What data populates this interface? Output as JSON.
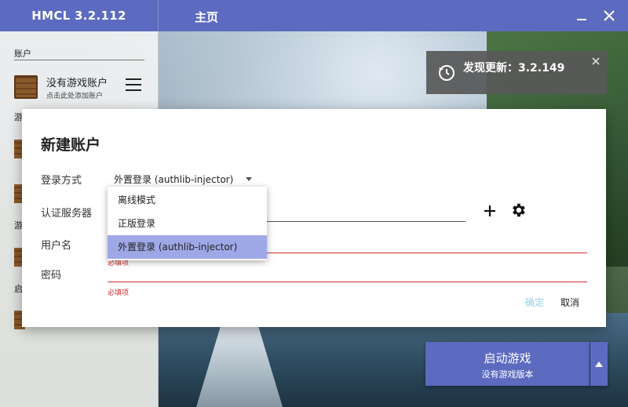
{
  "titlebar": {
    "app_title": "HMCL 3.2.112",
    "page_title": "主页"
  },
  "sidebar": {
    "account_section": "账户",
    "account_main": "没有游戏账户",
    "account_sub": "点击此处添加账户",
    "partial_labels": [
      "游",
      "游",
      "启"
    ]
  },
  "toast": {
    "text": "发现更新：3.2.149"
  },
  "dialog": {
    "title": "新建账户",
    "login_method_label": "登录方式",
    "login_method_value": "外置登录 (authlib-injector)",
    "auth_server_label": "认证服务器",
    "username_label": "用户名",
    "password_label": "密码",
    "required_hint": "必填项",
    "ok_label": "确定",
    "cancel_label": "取消"
  },
  "dropdown": {
    "options": [
      "离线模式",
      "正版登录",
      "外置登录 (authlib-injector)"
    ],
    "selected": "外置登录 (authlib-injector)"
  },
  "launch": {
    "main": "启动游戏",
    "sub": "没有游戏版本"
  },
  "colors": {
    "accent": "#5c6bc0",
    "selection": "#9fa8e6",
    "error": "#d32f2f",
    "ok_disabled": "#8fd0ee"
  },
  "icons": [
    "minimize-icon",
    "close-icon",
    "menu-icon",
    "refresh-icon",
    "plus-icon",
    "gear-icon",
    "chevron-up-icon",
    "dropdown-caret-icon"
  ]
}
